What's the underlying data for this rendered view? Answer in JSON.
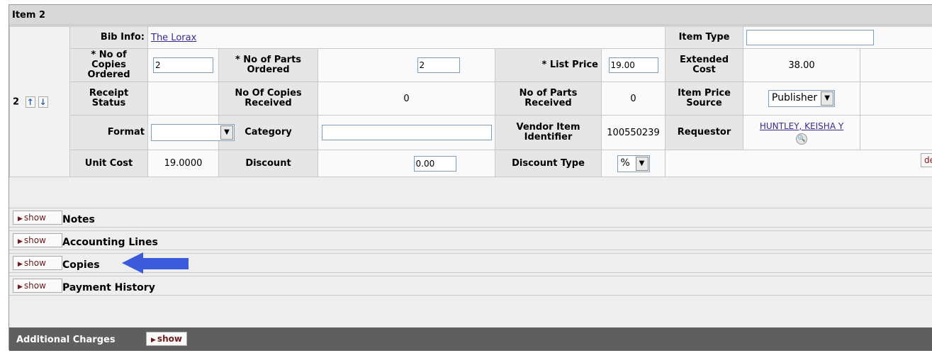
{
  "item": {
    "header": "Item 2",
    "line_number": "2",
    "up_icon": "↑",
    "down_icon": "↓",
    "bib_label": "Bib Info:",
    "bib_value": "The Lorax",
    "item_type_label": "Item Type",
    "item_type_value": "",
    "copies_ordered_label": "* No of Copies Ordered",
    "copies_ordered_value": "2",
    "parts_ordered_label": "* No of Parts Ordered",
    "parts_ordered_value": "2",
    "list_price_label": "* List Price",
    "list_price_value": "19.00",
    "extended_cost_label": "Extended Cost",
    "extended_cost_value": "38.00",
    "receipt_status_label": "Receipt Status",
    "receipt_status_value": "",
    "copies_received_label": "No Of Copies Received",
    "copies_received_value": "0",
    "parts_received_label": "No of Parts Received",
    "parts_received_value": "0",
    "price_source_label": "Item Price Source",
    "price_source_value": "Publisher",
    "format_label": "Format",
    "format_value": "",
    "category_label": "Category",
    "category_value": "",
    "vendor_item_id_label": "Vendor Item Identifier",
    "vendor_item_id_value": "100550239",
    "requestor_label": "Requestor",
    "requestor_value": "HUNTLEY, KEISHA Y",
    "unit_cost_label": "Unit Cost",
    "unit_cost_value": "19.0000",
    "discount_label": "Discount",
    "discount_value": "0.00",
    "discount_type_label": "Discount Type",
    "discount_type_value": "%",
    "delete_label": "delete"
  },
  "tabs": [
    {
      "show_label": "show",
      "label": "Notes"
    },
    {
      "show_label": "show",
      "label": "Accounting Lines"
    },
    {
      "show_label": "show",
      "label": "Copies"
    },
    {
      "show_label": "show",
      "label": "Payment History"
    }
  ],
  "additional_charges": {
    "label": "Additional Charges",
    "show_label": "show"
  },
  "colors": {
    "annotation_arrow": "#3b5bdb",
    "section_bar": "#5f5f5f"
  }
}
